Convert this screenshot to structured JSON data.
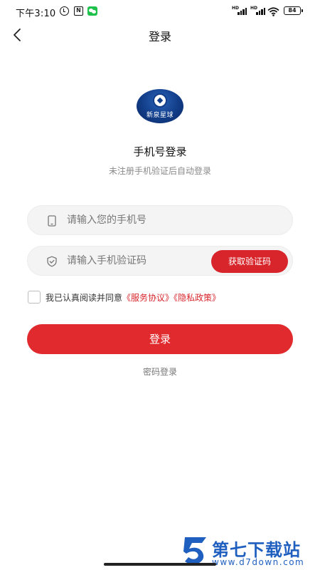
{
  "status_bar": {
    "time": "下午3:10",
    "nfc_label": "N",
    "battery_level": "84",
    "signal_labels": [
      "HD",
      "HD"
    ],
    "icons": [
      "alarm-icon",
      "nfc-icon",
      "wechat-icon",
      "signal-icon",
      "signal-icon",
      "wifi-icon",
      "battery-icon"
    ]
  },
  "nav": {
    "back_icon": "chevron-left-icon",
    "title": "登录"
  },
  "logo": {
    "text": "新泉星球"
  },
  "heading": "手机号登录",
  "subheading": "未注册手机验证后自动登录",
  "form": {
    "phone": {
      "value": "",
      "placeholder": "请输入您的手机号",
      "icon": "phone-icon"
    },
    "code": {
      "value": "",
      "placeholder": "请输入手机验证码",
      "icon": "shield-icon"
    },
    "get_code_label": "获取验证码"
  },
  "agreement": {
    "checked": false,
    "prefix": "我已认真阅读并同意",
    "service_link": "《服务协议》",
    "privacy_link": "《隐私政策》"
  },
  "login_button_label": "登录",
  "password_login_label": "密码登录",
  "watermark": {
    "title": "第七下载站",
    "url": "www.d7down.com"
  },
  "colors": {
    "accent": "#e02a2e",
    "link": "#d8252b",
    "watermark": "#1f5fbf"
  }
}
